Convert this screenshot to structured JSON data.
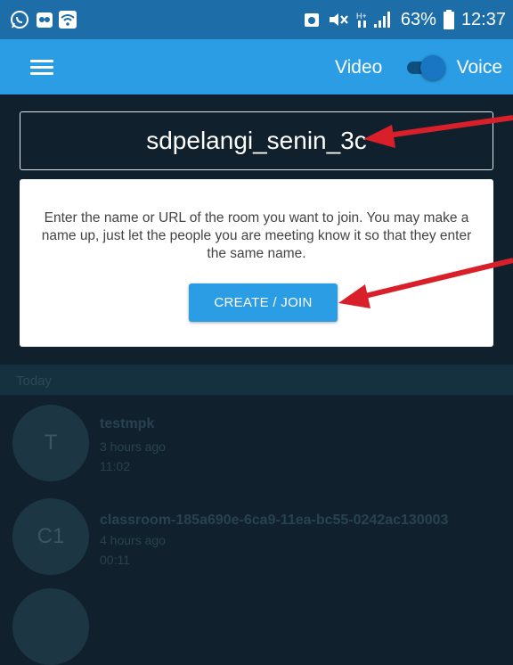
{
  "status_bar": {
    "battery_percent": "63%",
    "time": "12:37",
    "left_icons": [
      "whatsapp-icon",
      "app-icon",
      "wifi-icon"
    ],
    "right_icons": [
      "alarm-icon",
      "mute-icon",
      "signal-icon",
      "battery-icon"
    ]
  },
  "app_bar": {
    "menu_icon": "hamburger-menu-icon",
    "video_label": "Video",
    "voice_label": "Voice",
    "toggle_state": "voice"
  },
  "room": {
    "input_value": "sdpelangi_senin_3c"
  },
  "card": {
    "description": "Enter the name or URL of the room you want to join. You may make a name up, just let the people you are meeting know it so that they enter the same name.",
    "join_button_label": "CREATE / JOIN"
  },
  "recent": {
    "section_label": "Today",
    "items": [
      {
        "initials": "T",
        "title": "testmpk",
        "relative_time": "3 hours ago",
        "duration": "11:02"
      },
      {
        "initials": "C1",
        "title": "classroom-185a690e-6ca9-11ea-bc55-0242ac130003",
        "relative_time": "4 hours ago",
        "duration": "00:11"
      }
    ]
  },
  "colors": {
    "status_bar": "#1c6da8",
    "app_bar": "#2b9de4",
    "background": "#10212d",
    "accent": "#2b9de4",
    "annotation_arrow": "#d9202a"
  }
}
